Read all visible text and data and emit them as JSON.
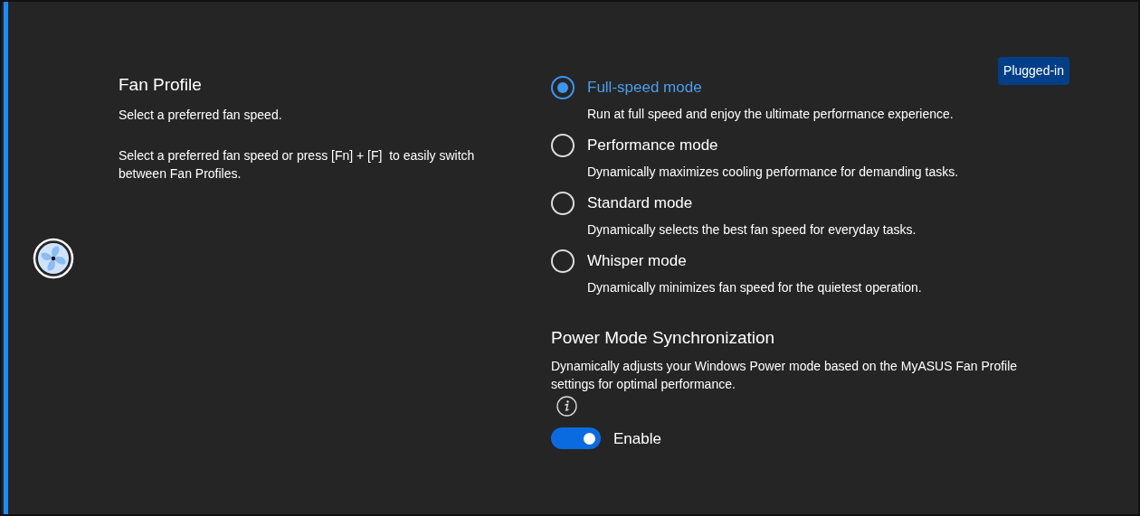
{
  "badge": "Plugged-in",
  "fan_profile": {
    "title": "Fan Profile",
    "subtitle": "Select a preferred fan speed.",
    "description": "Select a preferred fan speed or press [Fn] + [F]  to easily switch between Fan Profiles."
  },
  "modes": [
    {
      "label": "Full-speed mode",
      "description": "Run at full speed and enjoy the ultimate performance experience.",
      "selected": true
    },
    {
      "label": "Performance mode",
      "description": "Dynamically maximizes cooling performance for demanding tasks.",
      "selected": false
    },
    {
      "label": "Standard mode",
      "description": "Dynamically selects the best fan speed for everyday tasks.",
      "selected": false
    },
    {
      "label": "Whisper mode",
      "description": "Dynamically minimizes fan speed for the quietest operation.",
      "selected": false
    }
  ],
  "sync": {
    "title": "Power Mode Synchronization",
    "description": "Dynamically adjusts your Windows Power mode based on the MyASUS Fan Profile settings for optimal performance.",
    "toggle": {
      "label": "Enable",
      "on": true
    }
  }
}
